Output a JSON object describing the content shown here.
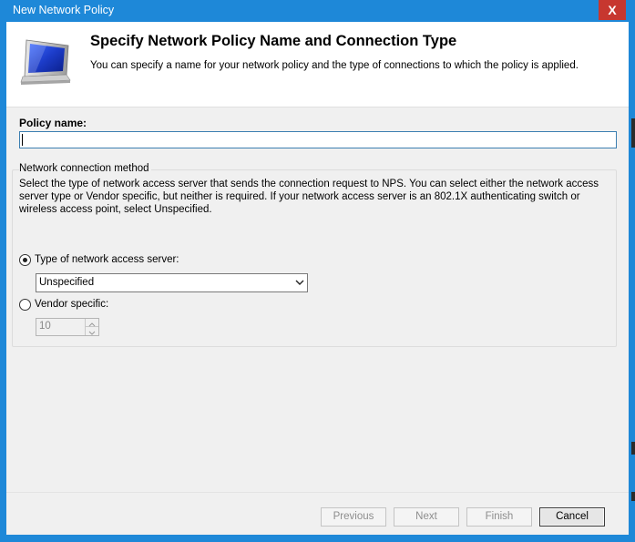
{
  "window": {
    "title": "New Network Policy",
    "close_glyph": "X"
  },
  "header": {
    "title": "Specify Network Policy Name and Connection Type",
    "subtitle": "You can specify a name for your network policy and the type of connections to which the policy is applied.",
    "icon": "monitor-icon"
  },
  "policy": {
    "label": "Policy name:",
    "value": "",
    "placeholder": ""
  },
  "connection_method": {
    "legend": "Network connection method",
    "description": "Select the type of network access server that sends the connection request to NPS. You can select either the network access server type or Vendor specific, but neither is required.  If your network access server is an 802.1X authenticating switch or wireless access point, select Unspecified.",
    "type_option_label": "Type of network access server:",
    "type_selected": true,
    "type_value": "Unspecified",
    "vendor_option_label": "Vendor specific:",
    "vendor_selected": false,
    "vendor_value": "10"
  },
  "buttons": {
    "previous": "Previous",
    "next": "Next",
    "finish": "Finish",
    "cancel": "Cancel"
  },
  "colors": {
    "titlebar": "#1e88d8",
    "close": "#c7372f",
    "input_border": "#3c7fb1"
  }
}
